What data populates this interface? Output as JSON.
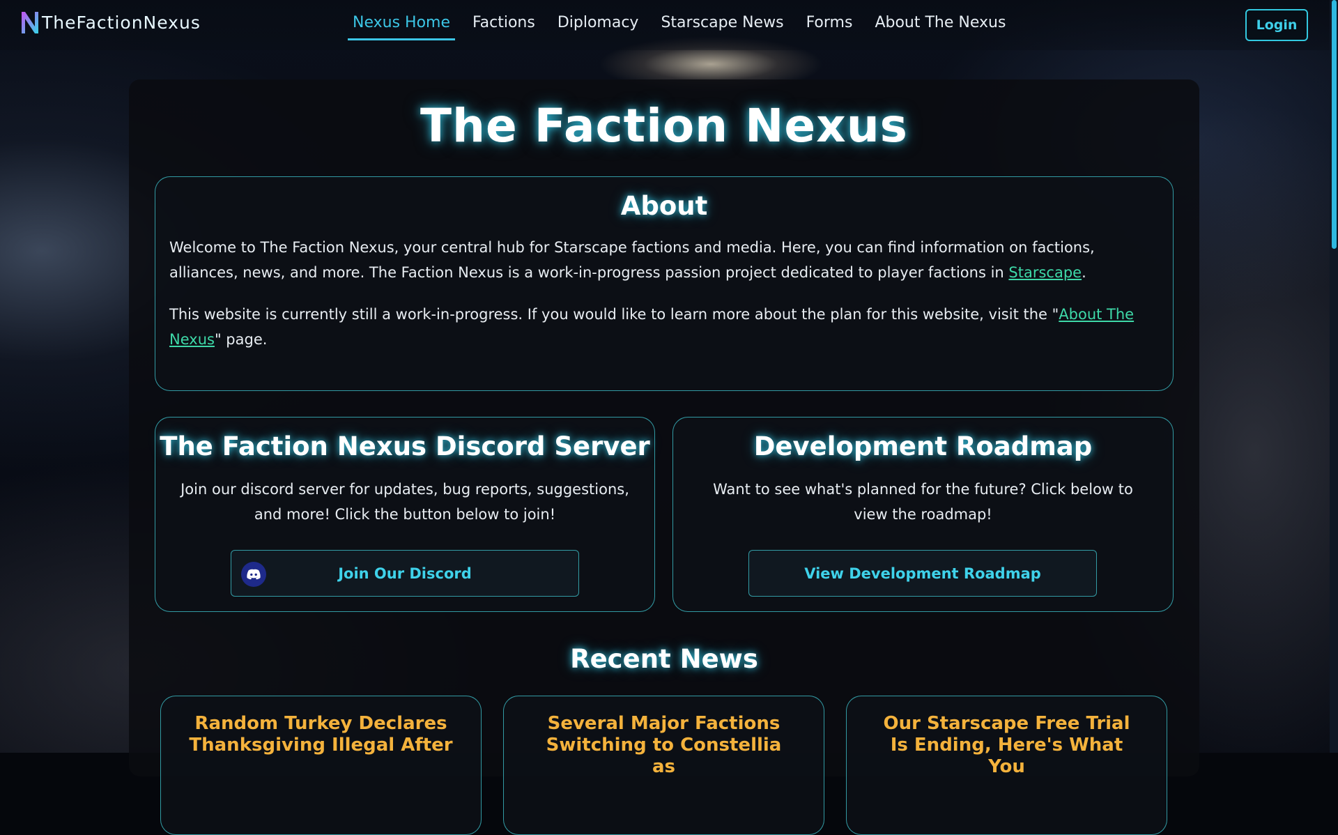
{
  "brand": {
    "name": "TheFactionNexus"
  },
  "nav": {
    "links": [
      {
        "label": "Nexus Home",
        "active": true
      },
      {
        "label": "Factions"
      },
      {
        "label": "Diplomacy"
      },
      {
        "label": "Starscape News"
      },
      {
        "label": "Forms"
      },
      {
        "label": "About The Nexus"
      }
    ],
    "login_label": "Login"
  },
  "page": {
    "title": "The Faction Nexus"
  },
  "about": {
    "heading": "About",
    "p1_text": "Welcome to The Faction Nexus, your central hub for Starscape factions and media. Here, you can find information on factions, alliances, news, and more. The Faction Nexus is a work-in-progress passion project dedicated to player factions in ",
    "p1_link": "Starscape",
    "p1_end": ".",
    "p2_text": "This website is currently still a work-in-progress. If you would like to learn more about the plan for this website, visit the \"",
    "p2_link": "About The Nexus",
    "p2_end": "\" page."
  },
  "discord": {
    "heading": "The Faction Nexus Discord Server",
    "text": "Join our discord server for updates, bug reports, suggestions, and more! Click the button below to join!",
    "button_label": "Join Our Discord"
  },
  "roadmap": {
    "heading": "Development Roadmap",
    "text": "Want to see what's planned for the future? Click below to view the roadmap!",
    "button_label": "View Development Roadmap"
  },
  "news": {
    "heading": "Recent News",
    "items": [
      {
        "title": "Random Turkey Declares Thanksgiving Illegal After"
      },
      {
        "title": "Several Major Factions Switching to Constellia as"
      },
      {
        "title": "Our Starscape Free Trial Is Ending, Here's What You"
      }
    ]
  },
  "colors": {
    "accent": "#3cc6e6",
    "link": "#3ed9a8",
    "news_title": "#f4b23c",
    "discord_blue": "#1e2a8a"
  }
}
